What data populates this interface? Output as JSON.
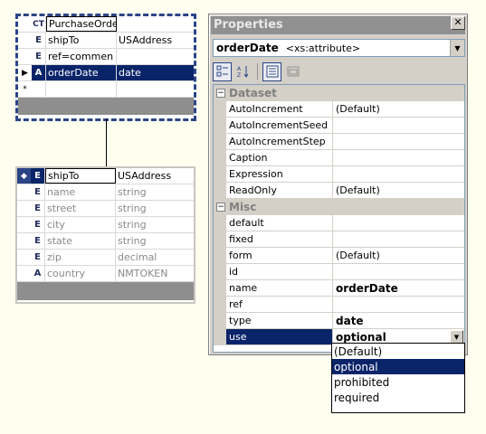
{
  "tables": {
    "purchase_order": {
      "rows": [
        {
          "marker": "",
          "kind": "CT",
          "name": "PurchaseOrder",
          "type": ""
        },
        {
          "marker": "",
          "kind": "E",
          "name": "shipTo",
          "type": "USAddress"
        },
        {
          "marker": "",
          "kind": "E",
          "name": "ref=commen",
          "type": ""
        },
        {
          "marker": "▶",
          "kind": "A",
          "name": "orderDate",
          "type": "date"
        },
        {
          "marker": "*",
          "kind": "",
          "name": "",
          "type": ""
        }
      ]
    },
    "ship_to": {
      "rows": [
        {
          "marker": "◆",
          "kind": "E",
          "name": "shipTo",
          "type": "USAddress"
        },
        {
          "marker": "",
          "kind": "E",
          "name": "name",
          "type": "string"
        },
        {
          "marker": "",
          "kind": "E",
          "name": "street",
          "type": "string"
        },
        {
          "marker": "",
          "kind": "E",
          "name": "city",
          "type": "string"
        },
        {
          "marker": "",
          "kind": "E",
          "name": "state",
          "type": "string"
        },
        {
          "marker": "",
          "kind": "E",
          "name": "zip",
          "type": "decimal"
        },
        {
          "marker": "",
          "kind": "A",
          "name": "country",
          "type": "NMTOKEN"
        }
      ]
    }
  },
  "properties": {
    "title": "Properties",
    "close_label": "✕",
    "object_name": "orderDate",
    "object_type": "<xs:attribute>",
    "toolbar": {
      "categorized_icon": "categorized-icon",
      "alphabetical_icon": "sort-az-icon",
      "properties_icon": "properties-icon",
      "pages_icon": "property-pages-icon"
    },
    "categories": [
      {
        "name": "Dataset",
        "items": [
          {
            "name": "AutoIncrement",
            "value": "(Default)"
          },
          {
            "name": "AutoIncrementSeed",
            "value": ""
          },
          {
            "name": "AutoIncrementStep",
            "value": ""
          },
          {
            "name": "Caption",
            "value": ""
          },
          {
            "name": "Expression",
            "value": ""
          },
          {
            "name": "ReadOnly",
            "value": "(Default)"
          }
        ]
      },
      {
        "name": "Misc",
        "items": [
          {
            "name": "default",
            "value": ""
          },
          {
            "name": "fixed",
            "value": ""
          },
          {
            "name": "form",
            "value": "(Default)"
          },
          {
            "name": "id",
            "value": ""
          },
          {
            "name": "name",
            "value": "orderDate"
          },
          {
            "name": "ref",
            "value": ""
          },
          {
            "name": "type",
            "value": "date"
          },
          {
            "name": "use",
            "value": "optional"
          }
        ]
      }
    ],
    "use_options": [
      "(Default)",
      "optional",
      "prohibited",
      "required"
    ],
    "use_selected": "optional"
  },
  "colors": {
    "selection": "#0a246a",
    "canvas": "#fffff0",
    "panel": "#d4d0c8"
  }
}
